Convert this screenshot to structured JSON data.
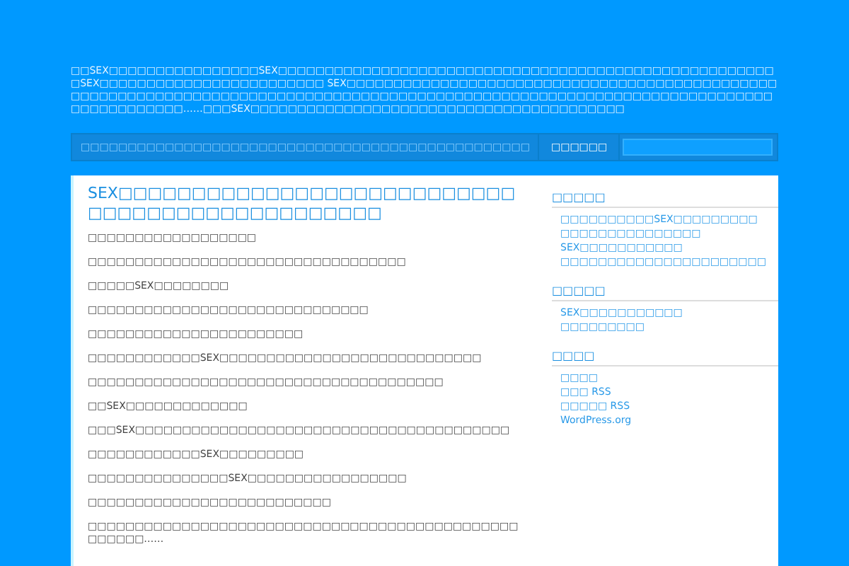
{
  "header": {
    "description": "□□SEX□□□□□□□□□□□□□□□□SEX□□□□□□□□□□□□□□□□□□□□□□□□□□□□□□□□□□□□□□□□□□□□□□□□□□□□□□SEX□□□□□□□□□□□□□□□□□□□□□□□□ SEX□□□□□□□□□□□□□□□□□□□□□□□□□□□□□□□□□□□□□□□□□□□□□□□□□□□□□□□□□□□□□□□□□□□□□□□□□□□□□□□□□□□□□□□□□□□□□□□□□□□□□□□□□□□□□□□□□□□□□□□□□□□□□□□□□□□□□……□□□SEX□□□□□□□□□□□□□□□□□□□□□□□□□□□□□□□□□□□□□□□□"
  },
  "nav": {
    "items": [
      {
        "label": "□□□□□□□□□□□□□□□□□□□□□□□□□□□□□□□□□□□□□□□□□□□□□□□□",
        "selected": false
      },
      {
        "label": "□□□□□□",
        "selected": true
      }
    ]
  },
  "post": {
    "title": "SEX□□□□□□□□□□□□□□□□□□□□□□□□□□□□□□□□□□□□□□□□□□□□□□□",
    "paragraphs": [
      "□□□□□□□□□□□□□□□□□□",
      "□□□□□□□□□□□□□□□□□□□□□□□□□□□□□□□□□□",
      "□□□□□SEX□□□□□□□□",
      "□□□□□□□□□□□□□□□□□□□□□□□□□□□□□□",
      "□□□□□□□□□□□□□□□□□□□□□□□",
      "□□□□□□□□□□□□SEX□□□□□□□□□□□□□□□□□□□□□□□□□□□□",
      "□□□□□□□□□□□□□□□□□□□□□□□□□□□□□□□□□□□□□□",
      "□□SEX□□□□□□□□□□□□□",
      "□□□SEX□□□□□□□□□□□□□□□□□□□□□□□□□□□□□□□□□□□□□□□□",
      "□□□□□□□□□□□□SEX□□□□□□□□□",
      "□□□□□□□□□□□□□□□SEX□□□□□□□□□□□□□□□□□",
      "□□□□□□□□□□□□□□□□□□□□□□□□□□",
      "□□□□□□□□□□□□□□□□□□□□□□□□□□□□□□□□□□□□□□□□□□□□□□□□□□□□……"
    ]
  },
  "sidebar": [
    {
      "heading": "□□□□□",
      "links": [
        "□□□□□□□□□□SEX□□□□□□□□□",
        "□□□□□□□□□□□□□□□",
        "SEX□□□□□□□□□□□",
        "□□□□□□□□□□□□□□□□□□□□□□"
      ]
    },
    {
      "heading": "□□□□□",
      "links": [
        "SEX□□□□□□□□□□□",
        "□□□□□□□□□"
      ]
    },
    {
      "heading": "□□□□",
      "links": [
        "□□□□",
        "□□□ RSS",
        "□□□□□ RSS",
        "WordPress.org"
      ]
    }
  ]
}
